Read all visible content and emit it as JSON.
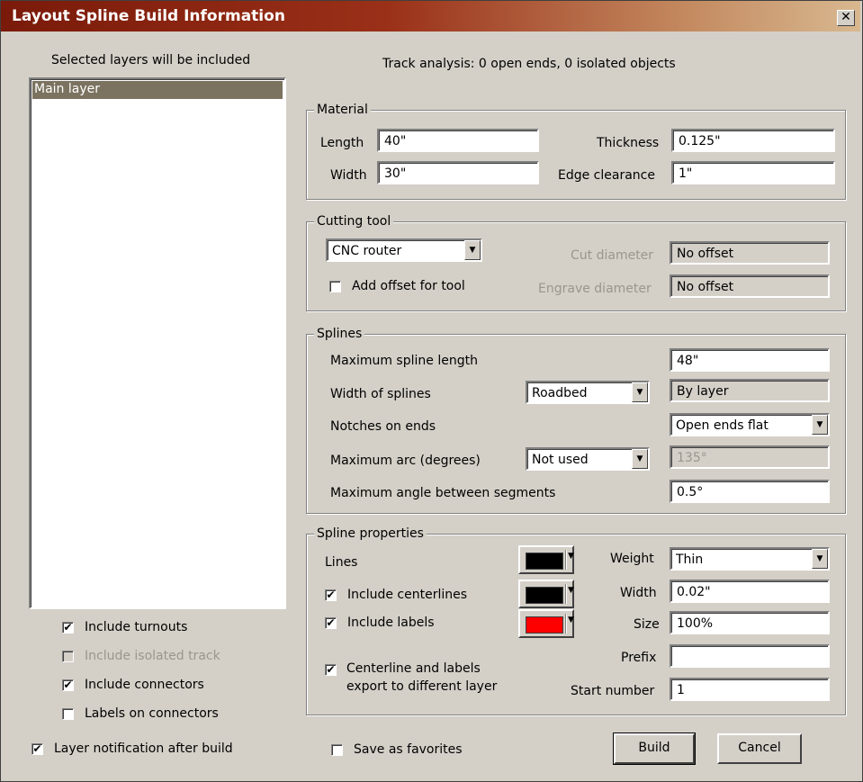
{
  "window": {
    "title": "Layout Spline Build Information",
    "close_glyph": "✕"
  },
  "left": {
    "header": "Selected layers will be included",
    "layers": [
      "Main layer"
    ],
    "options": {
      "include_turnouts": "Include turnouts",
      "include_isolated_track": "Include isolated track",
      "include_connectors": "Include connectors",
      "labels_on_connectors": "Labels on connectors"
    },
    "layer_notification": "Layer notification after build"
  },
  "track_analysis": "Track analysis: 0 open ends, 0 isolated objects",
  "material": {
    "title": "Material",
    "length_label": "Length",
    "length": "40\"",
    "width_label": "Width",
    "width": "30\"",
    "thickness_label": "Thickness",
    "thickness": "0.125\"",
    "edge_label": "Edge clearance",
    "edge": "1\""
  },
  "cutting_tool": {
    "title": "Cutting tool",
    "tool": "CNC router",
    "add_offset": "Add offset for tool",
    "cut_diameter_label": "Cut diameter",
    "cut_diameter": "No offset",
    "engrave_diameter_label": "Engrave diameter",
    "engrave_diameter": "No offset"
  },
  "splines": {
    "title": "Splines",
    "max_length_label": "Maximum spline length",
    "max_length": "48\"",
    "width_label": "Width of splines",
    "width_mode": "Roadbed",
    "width_value": "By layer",
    "notches_label": "Notches on ends",
    "notches": "Open ends flat",
    "max_arc_label": "Maximum arc (degrees)",
    "max_arc_mode": "Not used",
    "max_arc_value": "135°",
    "max_angle_label": "Maximum angle between segments",
    "max_angle": "0.5°"
  },
  "spline_props": {
    "title": "Spline properties",
    "lines_label": "Lines",
    "centerlines_label": "Include centerlines",
    "labels_label": "Include labels",
    "export_label_1": "Centerline and labels",
    "export_label_2": "export to different layer",
    "weight_label": "Weight",
    "weight": "Thin",
    "width_label": "Width",
    "width": "0.02\"",
    "size_label": "Size",
    "size": "100%",
    "prefix_label": "Prefix",
    "prefix": "",
    "start_label": "Start number",
    "start": "1",
    "colors": {
      "lines": "#000000",
      "centerlines": "#000000",
      "labels": "#ff0000"
    }
  },
  "footer": {
    "save_favorites": "Save as favorites",
    "build": "Build",
    "cancel": "Cancel"
  },
  "checkbox_states": {
    "include_turnouts": true,
    "include_isolated_track": false,
    "include_connectors": true,
    "labels_on_connectors": false,
    "layer_notification": true,
    "add_offset": false,
    "include_centerlines": true,
    "include_labels": true,
    "export_different_layer": true,
    "save_favorites": false
  },
  "icons": {
    "checkmark": "✔",
    "dropdown": "▼"
  }
}
